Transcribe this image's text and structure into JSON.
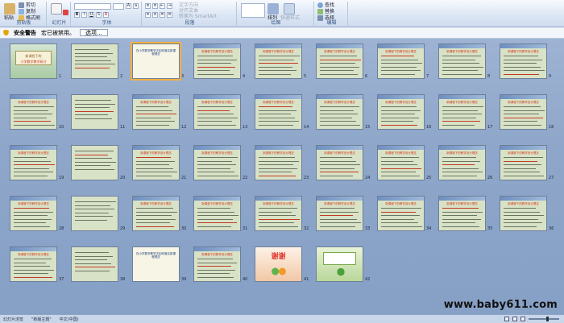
{
  "ribbon": {
    "clipboard": {
      "paste": "粘贴",
      "cut": "剪切",
      "copy": "复制",
      "format_painter": "格式刷",
      "group": "剪贴板"
    },
    "slides": {
      "new_slide": "新建\n幻灯片",
      "delete": "删除",
      "group": "幻灯片"
    },
    "font": {
      "group": "字体"
    },
    "paragraph": {
      "group": "段落",
      "text_direction": "文字方向",
      "align_text": "对齐文本",
      "convert_smartart": "转换为 SmartArt"
    },
    "drawing": {
      "arrange": "排列",
      "quick_styles": "快速样式",
      "group": "绘图"
    },
    "editing": {
      "find": "查找",
      "replace": "替换",
      "select": "选择",
      "group": "编辑"
    }
  },
  "security": {
    "warning": "安全警告",
    "message": "宏已被禁用。",
    "options_button": "选项..."
  },
  "slides": {
    "numbers": [
      "1",
      "2",
      "3",
      "4",
      "5",
      "6",
      "7",
      "8",
      "9",
      "10",
      "11",
      "12",
      "13",
      "14",
      "15",
      "16",
      "17",
      "18",
      "19",
      "20",
      "21",
      "22",
      "23",
      "24",
      "25",
      "26",
      "27",
      "28",
      "29",
      "30",
      "31",
      "32",
      "33",
      "34",
      "35",
      "36",
      "37",
      "38",
      "39",
      "40",
      "41",
      "42",
      "43"
    ],
    "slide1_title": "新课程下的",
    "slide1_subtitle": "小学数学教学研讨",
    "section_title": "新课程下的教学设计理念",
    "slide4_text": "在小学数学教学中如何落实新课程理念",
    "slide39_text": "在小学数学教学中如何落实新课程理念",
    "slide41_text": "谢谢",
    "slide43_text": "谢谢指导"
  },
  "watermark": "www.baby611.com",
  "status": {
    "view": "幻灯片浏览",
    "theme": "\"新版主题\"",
    "lang": "中文(中国)"
  }
}
